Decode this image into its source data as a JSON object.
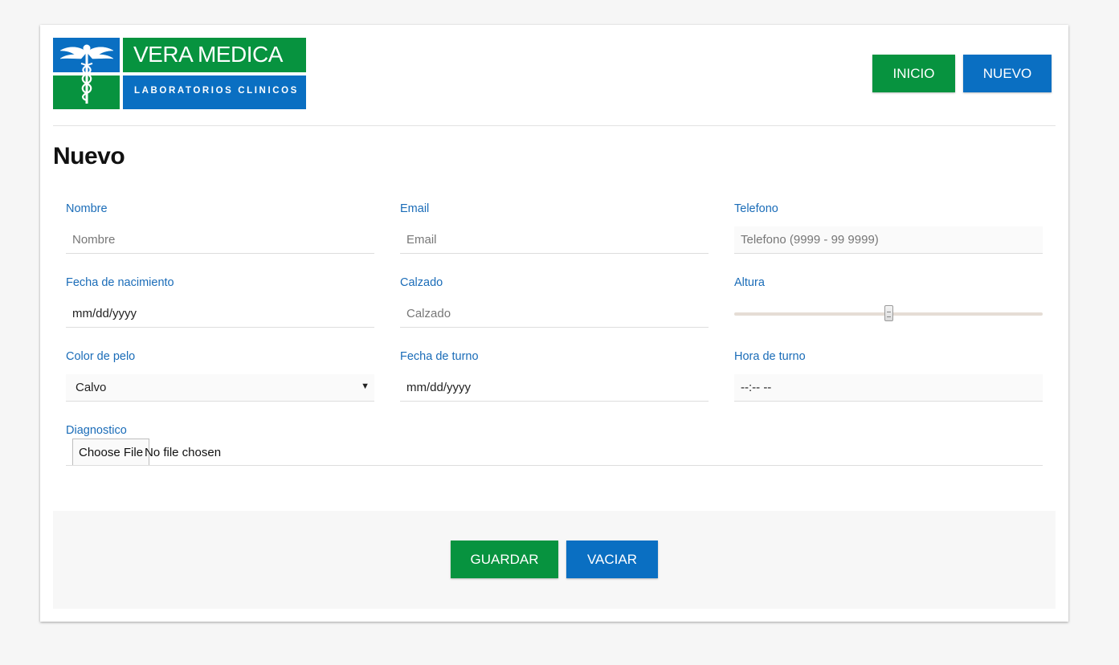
{
  "logo": {
    "title": "VERA MEDICA",
    "subtitle": "LABORATORIOS CLINICOS",
    "icon": "caduceus-icon"
  },
  "nav": {
    "inicio": "INICIO",
    "nuevo": "NUEVO"
  },
  "page": {
    "title": "Nuevo"
  },
  "form": {
    "nombre": {
      "label": "Nombre",
      "placeholder": "Nombre"
    },
    "email": {
      "label": "Email",
      "placeholder": "Email"
    },
    "telefono": {
      "label": "Telefono",
      "placeholder": "Telefono (9999 - 99 9999)"
    },
    "fecha_nacimiento": {
      "label": "Fecha de nacimiento",
      "value": "mm/dd/yyyy"
    },
    "calzado": {
      "label": "Calzado",
      "placeholder": "Calzado"
    },
    "altura": {
      "label": "Altura",
      "value_fraction": 0.5
    },
    "color_pelo": {
      "label": "Color de pelo",
      "selected": "Calvo"
    },
    "fecha_turno": {
      "label": "Fecha de turno",
      "value": "mm/dd/yyyy"
    },
    "hora_turno": {
      "label": "Hora de turno",
      "value": "--:-- --"
    },
    "diagnostico": {
      "label": "Diagnostico",
      "button": "Choose File",
      "status": "No file chosen"
    }
  },
  "actions": {
    "guardar": "GUARDAR",
    "vaciar": "VACIAR"
  },
  "colors": {
    "green": "#07933f",
    "blue": "#0a6fc2",
    "label": "#1a6cb8"
  }
}
